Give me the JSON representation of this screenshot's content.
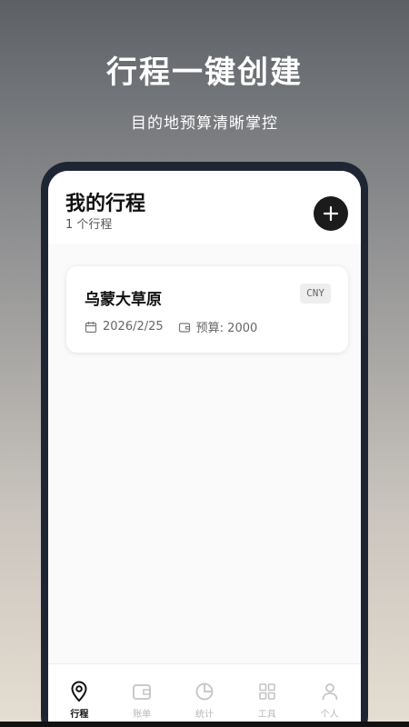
{
  "promo": {
    "title": "行程一键创建",
    "subtitle": "目的地预算清晰掌控"
  },
  "header": {
    "title": "我的行程",
    "count": "1 个行程",
    "add_icon": "plus-icon"
  },
  "trips": [
    {
      "name": "乌蒙大草原",
      "currency": "CNY",
      "date": "2026/2/25",
      "budget": "预算: 2000",
      "date_icon": "calendar-icon",
      "budget_icon": "wallet-icon"
    }
  ],
  "tabs": [
    {
      "label": "行程",
      "icon": "location-pin-icon",
      "active": true
    },
    {
      "label": "账单",
      "icon": "wallet-icon",
      "active": false
    },
    {
      "label": "统计",
      "icon": "pie-chart-icon",
      "active": false
    },
    {
      "label": "工具",
      "icon": "grid-icon",
      "active": false
    },
    {
      "label": "个人",
      "icon": "user-icon",
      "active": false
    }
  ],
  "colors": {
    "phone_frame": "#1f2633",
    "active_tab": "#111111",
    "inactive_tab": "#b8b8b8",
    "add_button": "#1b1b1b"
  }
}
